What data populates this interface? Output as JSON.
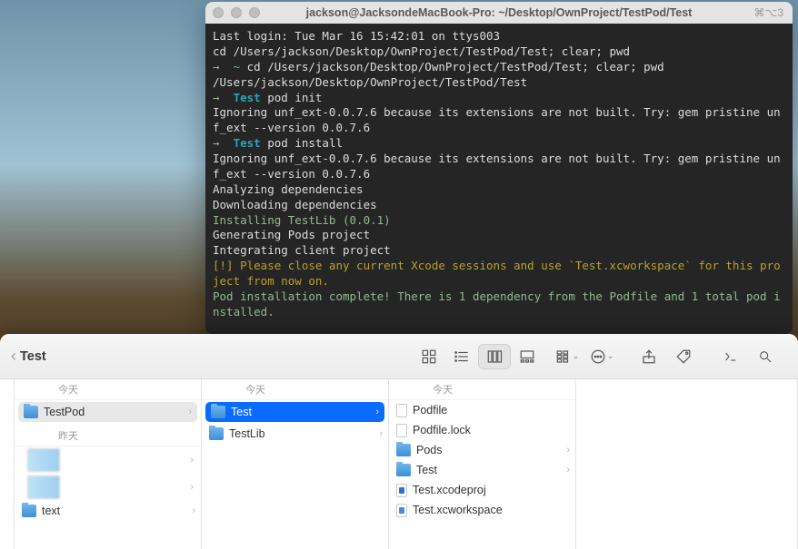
{
  "terminal": {
    "title": "jackson@JacksondeMacBook-Pro: ~/Desktop/OwnProject/TestPod/Test",
    "shortcut": "⌘⌥3",
    "lines": [
      {
        "segs": [
          {
            "t": "Last login: Tue Mar 16 15:42:01 on ttys003",
            "c": "c-white"
          }
        ]
      },
      {
        "segs": [
          {
            "t": "cd /Users/jackson/Desktop/OwnProject/TestPod/Test; clear; pwd",
            "c": "c-white"
          }
        ]
      },
      {
        "segs": [
          {
            "t": "→  ",
            "c": "c-green"
          },
          {
            "t": "~",
            "c": "c-teal"
          },
          {
            "t": " cd /Users/jackson/Desktop/OwnProject/TestPod/Test; clear; pwd",
            "c": "c-white"
          }
        ]
      },
      {
        "segs": [
          {
            "t": "/Users/jackson/Desktop/OwnProject/TestPod/Test",
            "c": "c-white"
          }
        ]
      },
      {
        "segs": [
          {
            "t": "→  ",
            "c": "c-green"
          },
          {
            "t": "Test",
            "c": "c-cyan"
          },
          {
            "t": " pod init",
            "c": "c-white"
          }
        ]
      },
      {
        "segs": [
          {
            "t": "Ignoring unf_ext-0.0.7.6 because its extensions are not built. Try: gem pristine unf_ext --version 0.0.7.6",
            "c": "c-white"
          }
        ]
      },
      {
        "segs": [
          {
            "t": "→  ",
            "c": "c-green"
          },
          {
            "t": "Test",
            "c": "c-cyan"
          },
          {
            "t": " pod install",
            "c": "c-white"
          }
        ]
      },
      {
        "segs": [
          {
            "t": "Ignoring unf_ext-0.0.7.6 because its extensions are not built. Try: gem pristine unf_ext --version 0.0.7.6",
            "c": "c-white"
          }
        ]
      },
      {
        "segs": [
          {
            "t": "Analyzing dependencies",
            "c": "c-white"
          }
        ]
      },
      {
        "segs": [
          {
            "t": "Downloading dependencies",
            "c": "c-white"
          }
        ]
      },
      {
        "segs": [
          {
            "t": "Installing TestLib (0.0.1)",
            "c": "c-green"
          }
        ]
      },
      {
        "segs": [
          {
            "t": "Generating Pods project",
            "c": "c-white"
          }
        ]
      },
      {
        "segs": [
          {
            "t": "Integrating client project",
            "c": "c-white"
          }
        ]
      },
      {
        "segs": [
          {
            "t": "",
            "c": "c-white"
          }
        ]
      },
      {
        "segs": [
          {
            "t": "[!] Please close any current Xcode sessions and use `Test.xcworkspace` for this project from now on.",
            "c": "c-yellow"
          }
        ]
      },
      {
        "segs": [
          {
            "t": "Pod installation complete! There is 1 dependency from the Podfile and 1 total pod installed.",
            "c": "c-green"
          }
        ]
      }
    ]
  },
  "finder": {
    "breadcrumb": "Test",
    "headers": {
      "today": "今天",
      "yesterday": "昨天"
    },
    "col1": {
      "today": [
        {
          "name": "TestPod",
          "selected": "gray",
          "arrow": true
        }
      ],
      "yesterday_thumbs": 2,
      "extra": {
        "name": "text",
        "arrow": true
      }
    },
    "col2": {
      "items": [
        {
          "name": "Test",
          "selected": "blue",
          "arrow": true
        },
        {
          "name": "TestLib",
          "arrow": true
        }
      ]
    },
    "col3": {
      "items": [
        {
          "name": "Podfile",
          "icon": "file"
        },
        {
          "name": "Podfile.lock",
          "icon": "file"
        },
        {
          "name": "Pods",
          "icon": "folder",
          "arrow": true
        },
        {
          "name": "Test",
          "icon": "folder",
          "arrow": true
        },
        {
          "name": "Test.xcodeproj",
          "icon": "proj"
        },
        {
          "name": "Test.xcworkspace",
          "icon": "ws"
        }
      ]
    }
  }
}
